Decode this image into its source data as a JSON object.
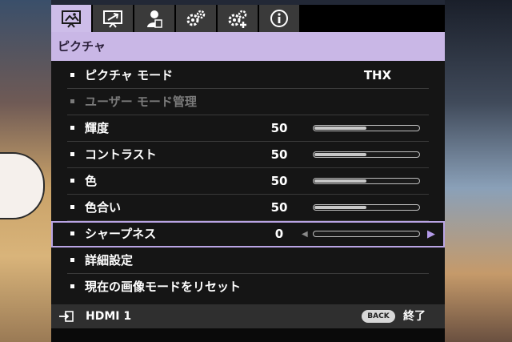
{
  "tabs": [
    {
      "icon": "picture-icon",
      "active": true
    },
    {
      "icon": "display-icon",
      "active": false
    },
    {
      "icon": "user-icon",
      "active": false
    },
    {
      "icon": "system-setup-icon",
      "active": false
    },
    {
      "icon": "advanced-setup-icon",
      "active": false
    },
    {
      "icon": "information-icon",
      "active": false
    }
  ],
  "header": {
    "title": "ピクチャ"
  },
  "rows": [
    {
      "label": "ピクチャ モード",
      "value": "THX",
      "type": "select"
    },
    {
      "label": "ユーザー モード管理",
      "type": "submenu",
      "disabled": true
    },
    {
      "label": "輝度",
      "value": "50",
      "type": "slider",
      "level": 0.5
    },
    {
      "label": "コントラスト",
      "value": "50",
      "type": "slider",
      "level": 0.5
    },
    {
      "label": "色",
      "value": "50",
      "type": "slider",
      "level": 0.5
    },
    {
      "label": "色合い",
      "value": "50",
      "type": "slider",
      "level": 0.5
    },
    {
      "label": "シャープネス",
      "value": "0",
      "type": "slider",
      "level": 0.0,
      "selected": true
    },
    {
      "label": "詳細設定",
      "type": "submenu"
    },
    {
      "label": "現在の画像モードをリセット",
      "type": "action"
    }
  ],
  "footer": {
    "source": "HDMI 1",
    "back_button": "BACK",
    "exit_label": "終了"
  },
  "colors": {
    "accent": "#c9b7e6",
    "selection": "#b9a4e4",
    "panel": "#151515"
  }
}
